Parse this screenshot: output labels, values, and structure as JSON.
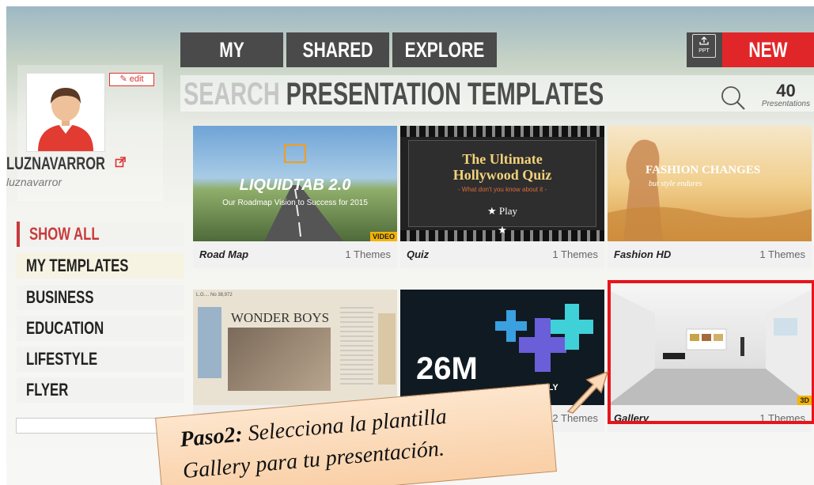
{
  "nav": {
    "tabs": [
      {
        "label": "MY"
      },
      {
        "label": "SHARED"
      },
      {
        "label": "EXPLORE"
      }
    ],
    "ppt_label": "PPT",
    "new_label": "NEW"
  },
  "profile": {
    "edit_label": "edit",
    "username": "LUZNAVARROR",
    "handle": "luznavarror"
  },
  "sidebar": {
    "items": [
      {
        "label": "SHOW ALL"
      },
      {
        "label": "MY TEMPLATES"
      },
      {
        "label": "BUSINESS"
      },
      {
        "label": "EDUCATION"
      },
      {
        "label": "LIFESTYLE"
      },
      {
        "label": "FLYER"
      }
    ]
  },
  "search": {
    "prefix": "SEARCH",
    "rest": " PRESENTATION TEMPLATES",
    "count": "40",
    "count_label": "Presentations"
  },
  "cards": [
    {
      "title": "Road Map",
      "themes": "1 Themes",
      "badge": "VIDEO",
      "thumb_title": "LIQUIDTAB 2.0",
      "thumb_sub": "Our Roadmap Vision to Success for 2015"
    },
    {
      "title": "Quiz",
      "themes": "1 Themes",
      "thumb_title1": "The Ultimate",
      "thumb_title2": "Hollywood Quiz",
      "thumb_sub": "- What don't you know about it -",
      "thumb_btn": "Play"
    },
    {
      "title": "Fashion HD",
      "themes": "1 Themes",
      "thumb_title": "FASHION CHANGES",
      "thumb_sub": "but style endures"
    },
    {
      "thumb_title": "WONDER BOYS",
      "thumb_small": "L.G.... No 38,972"
    },
    {
      "themes": "2 Themes",
      "thumb_big": "26M",
      "thumb_small": "THLY"
    },
    {
      "title": "Gallery",
      "themes": "1 Themes",
      "badge": "3D"
    }
  ],
  "callout": {
    "bold": "Paso2:",
    "line1": " Selecciona la plantilla",
    "line2": "Gallery para tu presentación."
  },
  "colors": {
    "nav_bg": "#4a4a4a",
    "new_red": "#e1262a",
    "selection_red": "#e8141b",
    "callout_bg": "#fbd9b8"
  }
}
